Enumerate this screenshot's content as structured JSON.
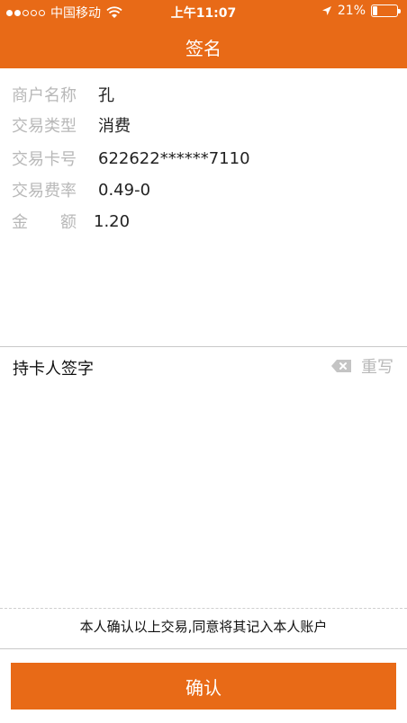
{
  "status_bar": {
    "carrier": "中国移动",
    "time": "上午11:07",
    "battery": "21%",
    "battery_level": 0.21
  },
  "nav": {
    "title": "签名"
  },
  "info": {
    "rows": [
      {
        "label": "商户名称",
        "value": "孔"
      },
      {
        "label": "交易类型",
        "value": "消费"
      },
      {
        "label": "交易卡号",
        "value": "622622******7110"
      },
      {
        "label": "交易费率",
        "value": "0.49-0"
      }
    ],
    "amount": {
      "label_a": "金",
      "label_b": "额",
      "value": "1.20"
    }
  },
  "signature": {
    "title": "持卡人签字",
    "rewrite_label": "重写"
  },
  "agreement_text": "本人确认以上交易,同意将其记入本人账户",
  "confirm_button": "确认",
  "colors": {
    "brand": "#e86a17",
    "label_gray": "#b8b8b8"
  },
  "icons": [
    "wifi-icon",
    "location-arrow-icon",
    "battery-icon",
    "backspace-icon"
  ]
}
